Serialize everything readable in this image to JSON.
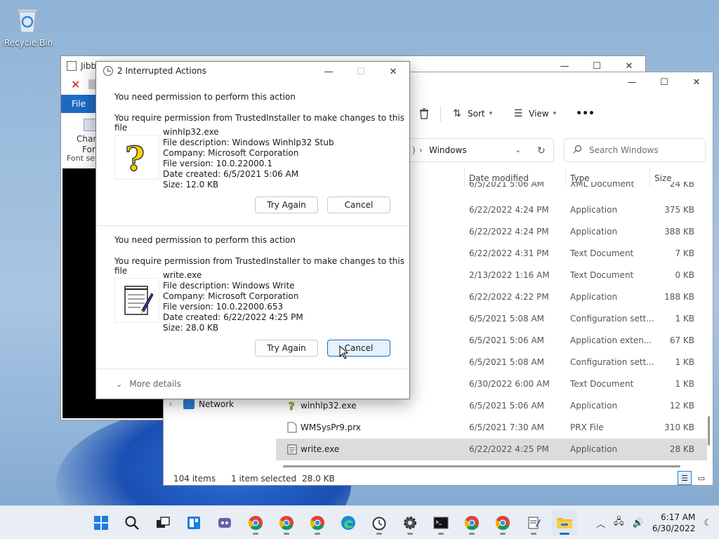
{
  "desktop": {
    "recycle_bin": "Recycle Bin"
  },
  "back_window": {
    "title": "Jibb",
    "file_tab": "File",
    "ribbon_chan": "Chan",
    "ribbon_fon": "Fon",
    "ribbon_font_settings": "Font set"
  },
  "explorer": {
    "toolbar": {
      "sort": "Sort",
      "view": "View",
      "more": "•••"
    },
    "breadcrumb": {
      "folder": "Windows"
    },
    "search_placeholder": "Search Windows",
    "columns": {
      "date": "Date modified",
      "type": "Type",
      "size": "Size"
    },
    "rows": [
      {
        "name": "",
        "date": "6/5/2021 5:06 AM",
        "type": "XML Document",
        "size": "24 KB"
      },
      {
        "name": "",
        "date": "6/22/2022 4:24 PM",
        "type": "Application",
        "size": "375 KB"
      },
      {
        "name": "",
        "date": "6/22/2022 4:24 PM",
        "type": "Application",
        "size": "388 KB"
      },
      {
        "name": "",
        "date": "6/22/2022 4:31 PM",
        "type": "Text Document",
        "size": "7 KB"
      },
      {
        "name": "",
        "date": "2/13/2022 1:16 AM",
        "type": "Text Document",
        "size": "0 KB"
      },
      {
        "name": "",
        "date": "6/22/2022 4:22 PM",
        "type": "Application",
        "size": "188 KB"
      },
      {
        "name": "",
        "date": "6/5/2021 5:08 AM",
        "type": "Configuration sett...",
        "size": "1 KB"
      },
      {
        "name": "",
        "date": "6/5/2021 5:06 AM",
        "type": "Application exten...",
        "size": "67 KB"
      },
      {
        "name": "",
        "date": "6/5/2021 5:08 AM",
        "type": "Configuration sett...",
        "size": "1 KB"
      },
      {
        "name": "",
        "date": "6/30/2022 6:00 AM",
        "type": "Text Document",
        "size": "1 KB"
      },
      {
        "name": "winhlp32.exe",
        "date": "6/5/2021 5:06 AM",
        "type": "Application",
        "size": "12 KB"
      },
      {
        "name": "WMSysPr9.prx",
        "date": "6/5/2021 7:30 AM",
        "type": "PRX File",
        "size": "310 KB"
      },
      {
        "name": "write.exe",
        "date": "6/22/2022 4:25 PM",
        "type": "Application",
        "size": "28 KB"
      }
    ],
    "nav_network": "Network",
    "status": {
      "items": "104 items",
      "selected": "1 item selected",
      "size": "28.0 KB"
    }
  },
  "dialog": {
    "title": "2 Interrupted Actions",
    "more_details": "More details",
    "sections": [
      {
        "heading": "You need permission to perform this action",
        "subheading": "You require permission from TrustedInstaller to make changes to this file",
        "file_name": "winhlp32.exe",
        "description": "File description: Windows Winhlp32 Stub",
        "company": "Company: Microsoft Corporation",
        "version": "File version: 10.0.22000.1",
        "created": "Date created: 6/5/2021 5:06 AM",
        "size": "Size: 12.0 KB",
        "try_again": "Try Again",
        "cancel": "Cancel"
      },
      {
        "heading": "You need permission to perform this action",
        "subheading": "You require permission from TrustedInstaller to make changes to this file",
        "file_name": "write.exe",
        "description": "File description: Windows Write",
        "company": "Company: Microsoft Corporation",
        "version": "File version: 10.0.22000.653",
        "created": "Date created: 6/22/2022 4:25 PM",
        "size": "Size: 28.0 KB",
        "try_again": "Try Again",
        "cancel": "Cancel"
      }
    ]
  },
  "taskbar": {
    "time": "6:17 AM",
    "date": "6/30/2022",
    "apps": [
      "windows-start-icon",
      "search-icon",
      "task-view-icon",
      "widgets-icon",
      "chat-icon",
      "chrome-icon",
      "chrome-icon",
      "chrome-icon",
      "edge-icon",
      "clock-app-icon",
      "settings-icon",
      "terminal-icon",
      "chrome-icon",
      "chrome-icon",
      "notepad-icon",
      "file-explorer-icon"
    ]
  },
  "colors": {
    "accent": "#1e6ac3",
    "selected_row": "#dcdcdc"
  }
}
